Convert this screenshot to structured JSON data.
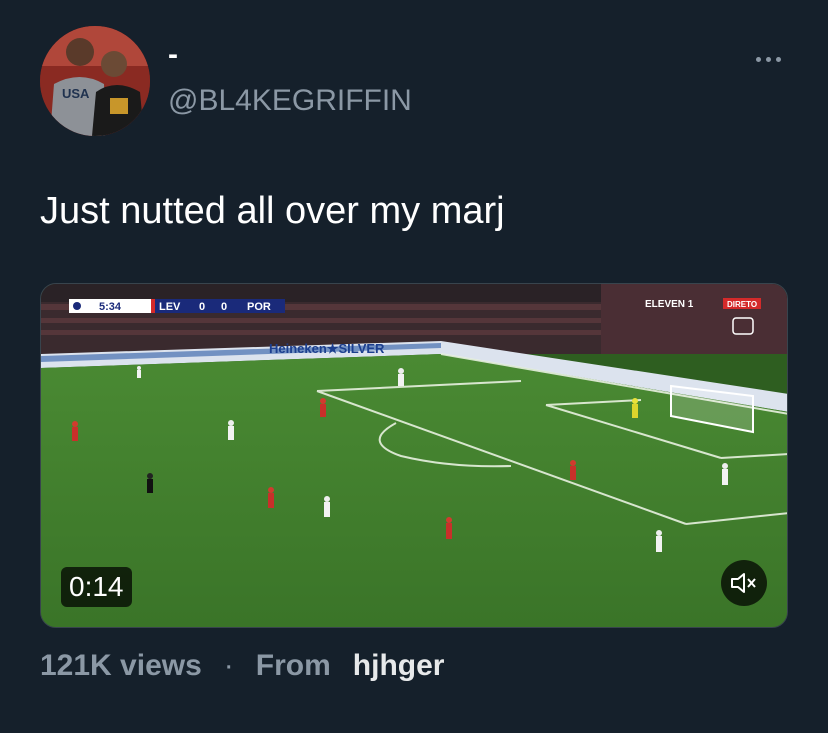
{
  "author": {
    "display_name": "-",
    "handle": "@BL4KEGRIFFIN",
    "avatar_shirt_text": "USA"
  },
  "menu": {
    "icon": "more-horizontal-icon"
  },
  "tweet": {
    "text": "Just nutted all over my marj"
  },
  "media": {
    "duration": "0:14",
    "mute_icon": "volume-muted-icon",
    "scoreboard": {
      "clock": "5:34",
      "home_team": "LEV",
      "home_score": "0",
      "away_score": "0",
      "away_team": "POR"
    },
    "broadcaster": "ELEVEN 1",
    "broadcaster_tag": "DIRETO",
    "ad_board_text": "Heineken★SILVER"
  },
  "stats": {
    "views": "121K views",
    "separator": "·",
    "from_label": "From",
    "source": "hjhger"
  },
  "colors": {
    "background": "#15202b",
    "secondary_text": "#8b98a5",
    "pitch": "#3f7a2c"
  }
}
